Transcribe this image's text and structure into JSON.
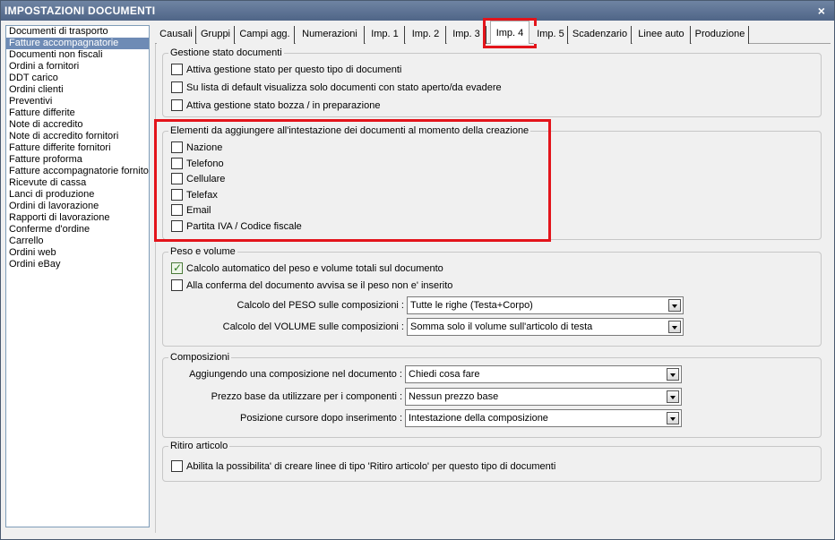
{
  "window": {
    "title": "IMPOSTAZIONI DOCUMENTI",
    "close_glyph": "×"
  },
  "doc_types": [
    {
      "label": "Documenti di trasporto",
      "selected": false
    },
    {
      "label": "Fatture accompagnatorie",
      "selected": true
    },
    {
      "label": "Documenti non fiscali",
      "selected": false
    },
    {
      "label": "Ordini a fornitori",
      "selected": false
    },
    {
      "label": "DDT carico",
      "selected": false
    },
    {
      "label": "Ordini clienti",
      "selected": false
    },
    {
      "label": "Preventivi",
      "selected": false
    },
    {
      "label": "Fatture differite",
      "selected": false
    },
    {
      "label": "Note di accredito",
      "selected": false
    },
    {
      "label": "Note di accredito fornitori",
      "selected": false
    },
    {
      "label": "Fatture differite fornitori",
      "selected": false
    },
    {
      "label": "Fatture proforma",
      "selected": false
    },
    {
      "label": "Fatture accompagnatorie fornito",
      "selected": false
    },
    {
      "label": "Ricevute di cassa",
      "selected": false
    },
    {
      "label": "Lanci di produzione",
      "selected": false
    },
    {
      "label": "Ordini di lavorazione",
      "selected": false
    },
    {
      "label": "Rapporti di lavorazione",
      "selected": false
    },
    {
      "label": "Conferme d'ordine",
      "selected": false
    },
    {
      "label": "Carrello",
      "selected": false
    },
    {
      "label": "Ordini web",
      "selected": false
    },
    {
      "label": "Ordini eBay",
      "selected": false
    }
  ],
  "tabs": [
    {
      "label": "Causali"
    },
    {
      "label": "Gruppi"
    },
    {
      "label": "Campi agg."
    },
    {
      "label": "Numerazioni"
    },
    {
      "label": "Imp. 1"
    },
    {
      "label": "Imp. 2"
    },
    {
      "label": "Imp. 3"
    },
    {
      "label": "Imp. 4",
      "active": true
    },
    {
      "label": "Imp. 5"
    },
    {
      "label": "Scadenzario"
    },
    {
      "label": "Linee auto"
    },
    {
      "label": "Produzione"
    }
  ],
  "gestione_stato": {
    "legend": "Gestione stato documenti",
    "items": [
      {
        "label": "Attiva gestione stato per questo tipo di documenti",
        "checked": false
      },
      {
        "label": "Su lista di default visualizza solo documenti con stato aperto/da evadere",
        "checked": false
      },
      {
        "label": "Attiva gestione stato bozza / in preparazione",
        "checked": false
      }
    ]
  },
  "intestazione": {
    "legend": "Elementi da aggiungere all'intestazione dei documenti al momento della creazione",
    "items": [
      {
        "label": "Nazione",
        "checked": false
      },
      {
        "label": "Telefono",
        "checked": false
      },
      {
        "label": "Cellulare",
        "checked": false
      },
      {
        "label": "Telefax",
        "checked": false
      },
      {
        "label": "Email",
        "checked": false
      },
      {
        "label": "Partita IVA / Codice fiscale",
        "checked": false
      }
    ]
  },
  "peso_volume": {
    "legend": "Peso e volume",
    "items": [
      {
        "label": "Calcolo automatico del peso e volume totali sul documento",
        "checked": true
      },
      {
        "label": "Alla conferma del documento avvisa se il peso non e' inserito",
        "checked": false
      }
    ],
    "selects": [
      {
        "label": "Calcolo del PESO sulle composizioni :",
        "value": "Tutte le righe (Testa+Corpo)"
      },
      {
        "label": "Calcolo del VOLUME sulle composizioni :",
        "value": "Somma solo il volume sull'articolo di testa"
      }
    ]
  },
  "composizioni": {
    "legend": "Composizioni",
    "selects": [
      {
        "label": "Aggiungendo una composizione nel documento :",
        "value": "Chiedi cosa fare"
      },
      {
        "label": "Prezzo base da utilizzare per i componenti :",
        "value": "Nessun prezzo base"
      },
      {
        "label": "Posizione cursore dopo inserimento :",
        "value": "Intestazione della composizione"
      }
    ]
  },
  "ritiro": {
    "legend": "Ritiro articolo",
    "items": [
      {
        "label": "Abilita la possibilita' di creare linee di tipo 'Ritiro articolo' per questo tipo di documenti",
        "checked": false
      }
    ]
  },
  "colors": {
    "title_bar": "#5a7092",
    "selection": "#6e8bb5",
    "highlight": "#e3141b"
  }
}
